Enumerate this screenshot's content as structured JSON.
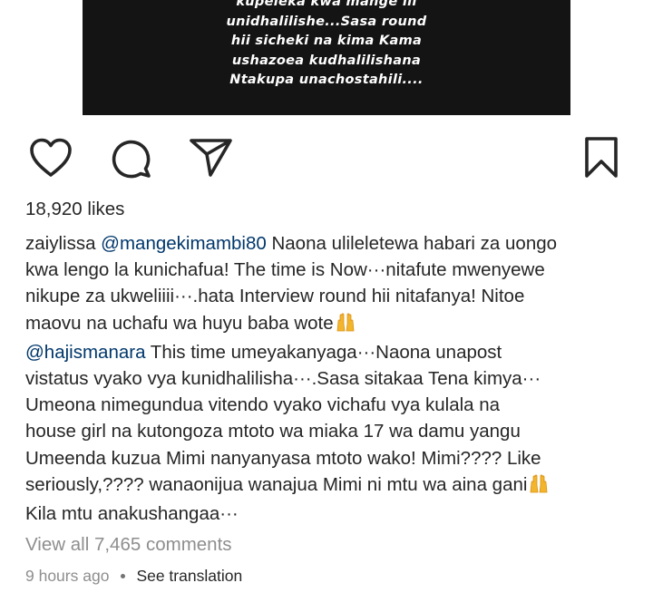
{
  "post_image": {
    "lines": [
      "kupeleka kwa mange ili",
      "unidhalilishe...Sasa round",
      "hii sicheki na kima Kama",
      "ushazoea kudhalilishana",
      "Ntakupa unachostahili...."
    ]
  },
  "actions": {
    "like_icon": "heart-outline-icon",
    "comment_icon": "comment-bubble-icon",
    "share_icon": "paper-plane-icon",
    "save_icon": "bookmark-outline-icon"
  },
  "likes_text": "18,920 likes",
  "caption": {
    "username": "zaiylissa",
    "mention_1": "@mangekimambi80",
    "line_1_text": " Naona ulileletewa habari za uongo",
    "line_2": "kwa lengo la kunichafua! The time is Now···nitafute mwenyewe",
    "line_3": "nikupe za ukweliiii···.hata Interview round hii nitafanya! Nitoe",
    "line_4": "maovu na uchafu wa huyu baba wote",
    "mention_2": "@hajismanara",
    "line_5_text": " This time umeyakanyaga···Naona unapost",
    "line_6": "vistatus vyako vya kunidhalilisha···.Sasa sitakaa Tena kimya···",
    "line_7": "Umeona nimegundua vitendo vyako vichafu vya kulala na",
    "line_8": "house girl na kutongoza mtoto wa miaka 17 wa damu yangu",
    "line_9": "Umeenda kuzua Mimi nanyanyasa mtoto wako! Mimi???? Like",
    "line_10": "seriously,???? wanaonijua wanajua Mimi ni mtu wa aina gani",
    "line_11": "Kila mtu anakushangaa···",
    "emoji": "raising-hands-emoji"
  },
  "view_comments": "View all 7,465 comments",
  "timestamp": "9 hours ago",
  "see_translation": "See translation"
}
